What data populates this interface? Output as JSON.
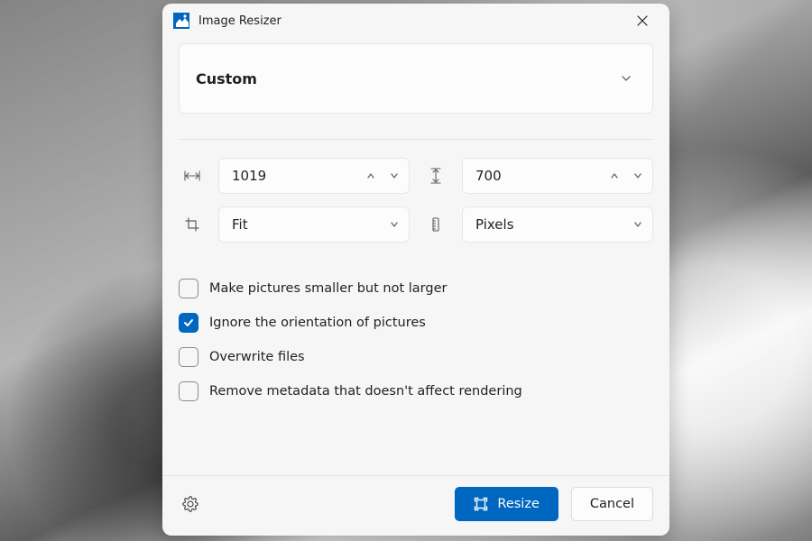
{
  "title": "Image Resizer",
  "preset": {
    "label": "Custom"
  },
  "size": {
    "width": "1019",
    "height": "700",
    "fit_mode": "Fit",
    "unit": "Pixels"
  },
  "options": {
    "smaller_not_larger": {
      "label": "Make pictures smaller but not larger",
      "checked": false
    },
    "ignore_orientation": {
      "label": "Ignore the orientation of pictures",
      "checked": true
    },
    "overwrite_files": {
      "label": "Overwrite files",
      "checked": false
    },
    "remove_metadata": {
      "label": "Remove metadata that doesn't affect rendering",
      "checked": false
    }
  },
  "footer": {
    "resize": "Resize",
    "cancel": "Cancel"
  },
  "colors": {
    "accent": "#0067c0"
  }
}
